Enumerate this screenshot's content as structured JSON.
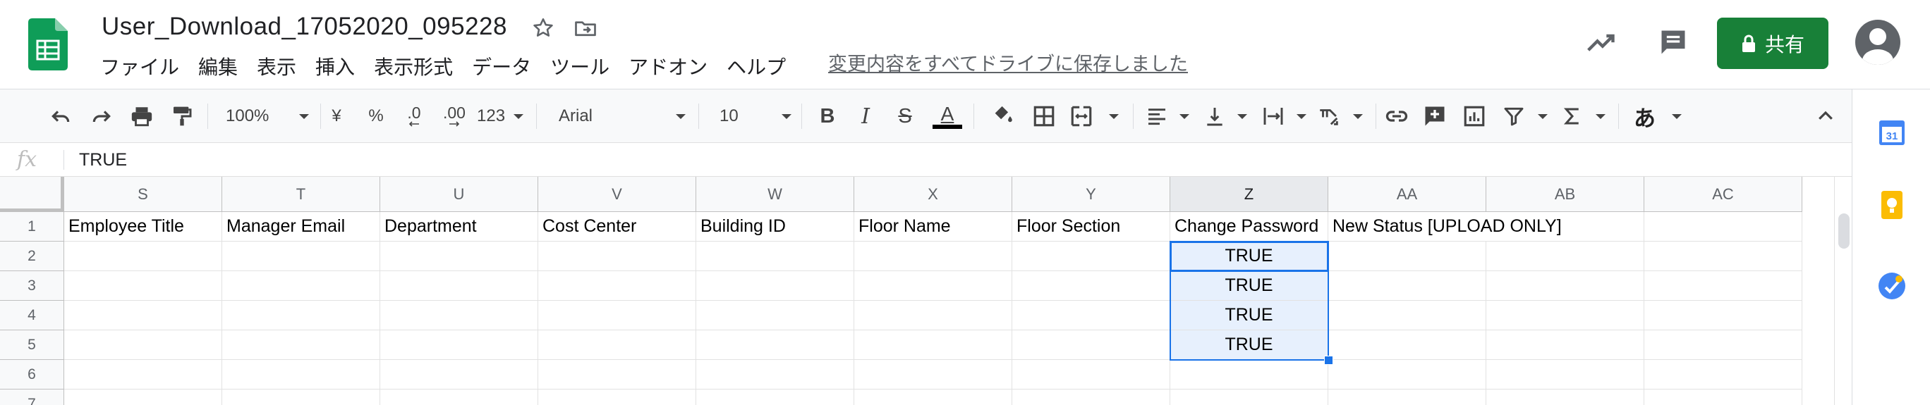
{
  "doc": {
    "title": "User_Download_17052020_095228",
    "save_status": "変更内容をすべてドライブに保存しました"
  },
  "menu": [
    "ファイル",
    "編集",
    "表示",
    "挿入",
    "表示形式",
    "データ",
    "ツール",
    "アドオン",
    "ヘルプ"
  ],
  "header": {
    "share_label": "共有",
    "icons": [
      "trending-up-icon",
      "comment-icon",
      "lock-icon",
      "account-avatar-icon"
    ]
  },
  "toolbar": {
    "zoom": "100%",
    "currency": "¥",
    "percent": "%",
    "decrease_decimal": ".0",
    "increase_decimal": ".00",
    "number_format": "123",
    "font": "Arial",
    "font_size": "10",
    "bold": "B",
    "italic": "I",
    "strike": "S",
    "text_color": "A",
    "input_tools": "あ"
  },
  "formula": {
    "fx": "fx",
    "value": "TRUE"
  },
  "columns": [
    "S",
    "T",
    "U",
    "V",
    "W",
    "X",
    "Y",
    "Z",
    "AA",
    "AB",
    "AC"
  ],
  "selected_column": "Z",
  "rows": [
    "1",
    "2",
    "3",
    "4",
    "5",
    "6",
    "7"
  ],
  "cells": {
    "row1": [
      "Employee Title",
      "Manager Email",
      "Department",
      "Cost Center",
      "Building ID",
      "Floor Name",
      "Floor Section",
      "Change Password",
      "New Status [UPLOAD ONLY]",
      "",
      ""
    ],
    "z_values": [
      "TRUE",
      "TRUE",
      "TRUE",
      "TRUE"
    ]
  },
  "side_panel_icons": [
    "calendar-icon",
    "keep-icon",
    "tasks-icon"
  ],
  "colors": {
    "share_green": "#188038",
    "selection_blue": "#1a73e8",
    "selection_fill": "#e7f0fd",
    "sheets_green": "#0f9d58"
  }
}
